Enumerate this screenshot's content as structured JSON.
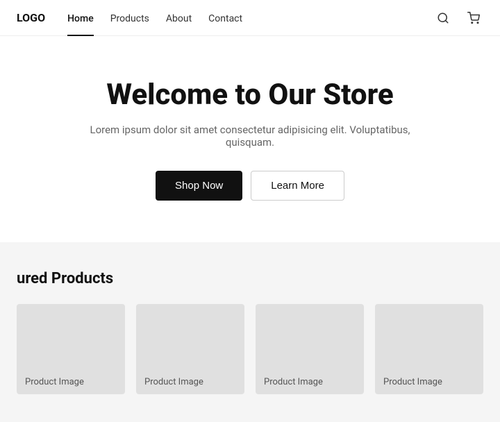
{
  "nav": {
    "logo": "LOGO",
    "links": [
      {
        "label": "Home",
        "active": true
      },
      {
        "label": "Products",
        "active": false
      },
      {
        "label": "About",
        "active": false
      },
      {
        "label": "Contact",
        "active": false
      }
    ],
    "search_icon": "🔍",
    "cart_label": "🛒"
  },
  "hero": {
    "title": "Welcome to Our Store",
    "subtitle": "Lorem ipsum dolor sit amet consectetur adipisicing elit. Voluptatibus, quisquam.",
    "cta_primary": "Shop Now",
    "cta_secondary": "Learn More"
  },
  "featured": {
    "section_title": "ured Products",
    "products": [
      {
        "image_label": "Product Image"
      },
      {
        "image_label": "Product Image"
      },
      {
        "image_label": "Product Image"
      },
      {
        "image_label": "Product Image"
      }
    ]
  }
}
